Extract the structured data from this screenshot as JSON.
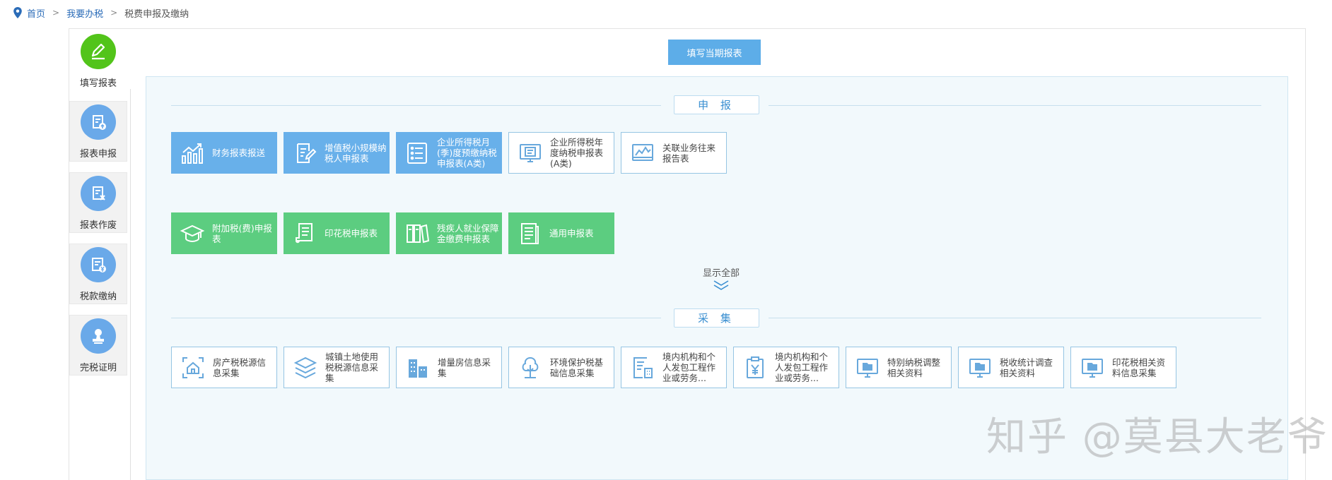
{
  "breadcrumb": {
    "home": "首页",
    "level2": "我要办税",
    "current": "税费申报及缴纳",
    "separator": ">"
  },
  "sidebar": {
    "items": [
      {
        "label": "填写报表",
        "icon": "pencil-icon",
        "color": "#52c41a",
        "active": true
      },
      {
        "label": "报表申报",
        "icon": "report-upload-icon",
        "color": "#6aa9e9",
        "active": false
      },
      {
        "label": "报表作废",
        "icon": "report-void-icon",
        "color": "#6aa9e9",
        "active": false
      },
      {
        "label": "税款缴纳",
        "icon": "tax-payment-icon",
        "color": "#6aa9e9",
        "active": false
      },
      {
        "label": "完税证明",
        "icon": "tax-certificate-icon",
        "color": "#6aa9e9",
        "active": false
      }
    ]
  },
  "main": {
    "fill_current_button": "填写当期报表",
    "declare_section": {
      "title": "申 报",
      "tiles": [
        {
          "label": "财务报表报送",
          "icon": "bar-chart-icon",
          "style": "blue"
        },
        {
          "label": "增值税小规模纳税人申报表",
          "icon": "edit-document-icon",
          "style": "blue"
        },
        {
          "label": "企业所得税月(季)度预缴纳税申报表(A类)",
          "icon": "list-icon",
          "style": "blue"
        },
        {
          "label": "企业所得税年度纳税申报表(A类)",
          "icon": "monitor-report-icon",
          "style": "white"
        },
        {
          "label": "关联业务往来报告表",
          "icon": "line-chart-icon",
          "style": "white"
        },
        {
          "label": "附加税(费)申报表",
          "icon": "graduation-cap-icon",
          "style": "green"
        },
        {
          "label": "印花税申报表",
          "icon": "scroll-document-icon",
          "style": "green"
        },
        {
          "label": "残疾人就业保障金缴费申报表",
          "icon": "binders-icon",
          "style": "green"
        },
        {
          "label": "通用申报表",
          "icon": "document-icon",
          "style": "green"
        }
      ]
    },
    "show_all": "显示全部",
    "collect_section": {
      "title": "采 集",
      "tiles": [
        {
          "label": "房产税税源信息采集",
          "icon": "house-scan-icon"
        },
        {
          "label": "城镇土地使用税税源信息采集",
          "icon": "layers-icon"
        },
        {
          "label": "增量房信息采集",
          "icon": "buildings-icon"
        },
        {
          "label": "环境保护税基础信息采集",
          "icon": "tree-icon"
        },
        {
          "label": "境内机构和个人发包工程作业或劳务...",
          "icon": "building-form-icon"
        },
        {
          "label": "境内机构和个人发包工程作业或劳务...",
          "icon": "clipboard-yen-icon"
        },
        {
          "label": "特别纳税调整相关资料",
          "icon": "monitor-folder-icon"
        },
        {
          "label": "税收统计调查相关资料",
          "icon": "monitor-folder-icon"
        },
        {
          "label": "印花税相关资料信息采集",
          "icon": "monitor-folder-icon"
        }
      ]
    }
  },
  "watermark": "知乎 @莫县大老爷",
  "colors": {
    "blue_tile": "#68b0ea",
    "green_tile": "#5ccd80",
    "accent": "#5dade8",
    "link": "#2b6cb8"
  }
}
